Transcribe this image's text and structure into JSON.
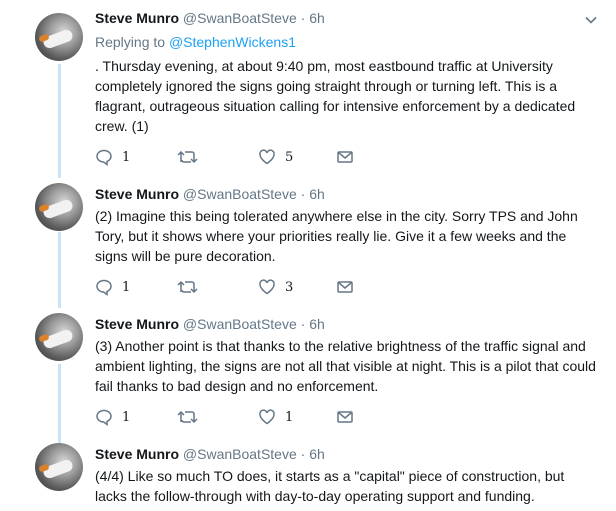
{
  "tweets": [
    {
      "name": "Steve Munro",
      "handle": "@SwanBoatSteve",
      "separator": "·",
      "time": "6h",
      "reply_prefix": "Replying to",
      "reply_target": "@StephenWickens1",
      "text": ". Thursday evening, at about 9:40 pm, most eastbound traffic at University completely ignored the signs going straight through or turning left. This is a flagrant, outrageous situation calling for intensive enforcement by a dedicated crew. (1)",
      "replies": "1",
      "retweets": "",
      "likes": "5"
    },
    {
      "name": "Steve Munro",
      "handle": "@SwanBoatSteve",
      "separator": "·",
      "time": "6h",
      "text": "(2) Imagine this being tolerated anywhere else in the city. Sorry TPS and John Tory, but it shows where your priorities really lie. Give it a few weeks and the signs will be pure decoration.",
      "replies": "1",
      "retweets": "",
      "likes": "3"
    },
    {
      "name": "Steve Munro",
      "handle": "@SwanBoatSteve",
      "separator": "·",
      "time": "6h",
      "text": "(3) Another point is that thanks to the relative brightness of the traffic signal and ambient lighting, the signs are not all that visible at night. This is a pilot that could fail thanks to bad design and no enforcement.",
      "replies": "1",
      "retweets": "",
      "likes": "1"
    },
    {
      "name": "Steve Munro",
      "handle": "@SwanBoatSteve",
      "separator": "·",
      "time": "6h",
      "text": "(4/4) Like so much TO does, it starts as a \"capital\" piece of construction, but lacks the follow-through with day-to-day operating support and funding."
    }
  ],
  "colors": {
    "link": "#1da1f2",
    "muted": "#657786",
    "thread_line": "#cbe3f5"
  },
  "icons": [
    "reply-icon",
    "retweet-icon",
    "like-icon",
    "message-icon",
    "caret-down-icon"
  ]
}
